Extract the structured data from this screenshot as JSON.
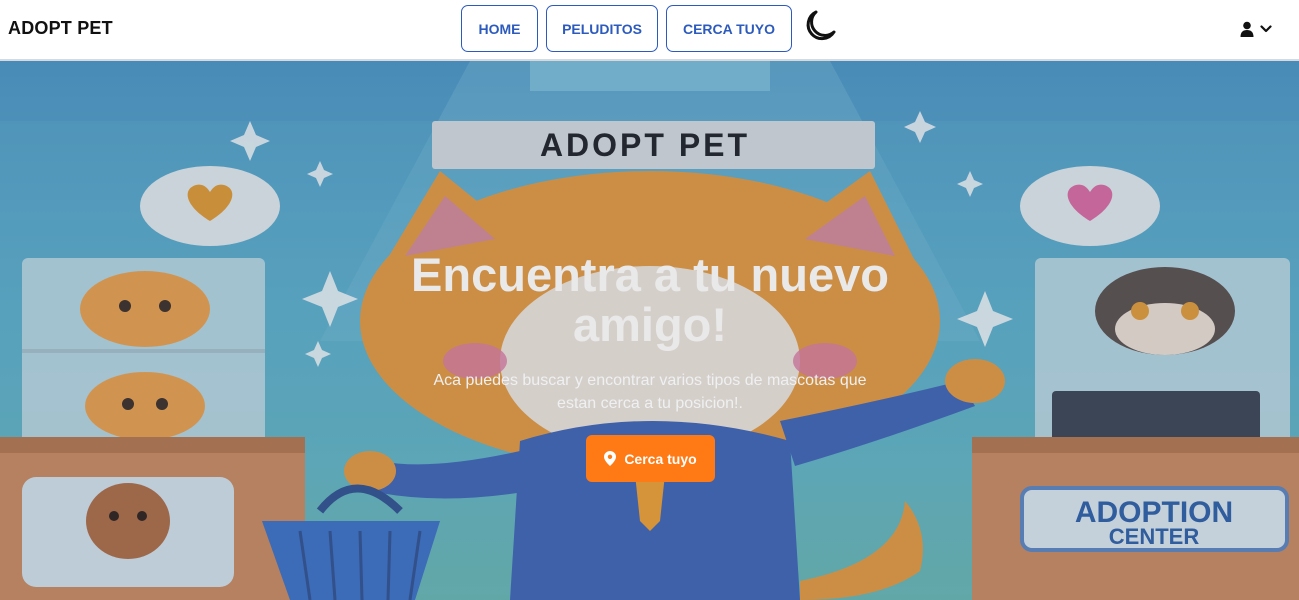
{
  "navbar": {
    "brand": "ADOPT PET",
    "links": [
      {
        "label": "HOME"
      },
      {
        "label": "PELUDITOS"
      },
      {
        "label": "CERCA TUYO"
      }
    ],
    "theme_toggle_icon": "moon-icon",
    "user_icon": "user-icon",
    "chevron_icon": "chevron-down-icon",
    "accent_color": "#2d5bbd"
  },
  "hero": {
    "sign_text": "ADOPT PET",
    "board_line1": "ADOPTION",
    "board_line2": "CENTER",
    "title": "Encuentra a tu nuevo amigo!",
    "subtitle": "Aca puedes buscar y encontrar varios tipos de mascotas que estan cerca a tu posicion!.",
    "cta_label": "Cerca tuyo",
    "cta_icon": "map-pin-icon",
    "cta_color": "#ff7a14"
  }
}
